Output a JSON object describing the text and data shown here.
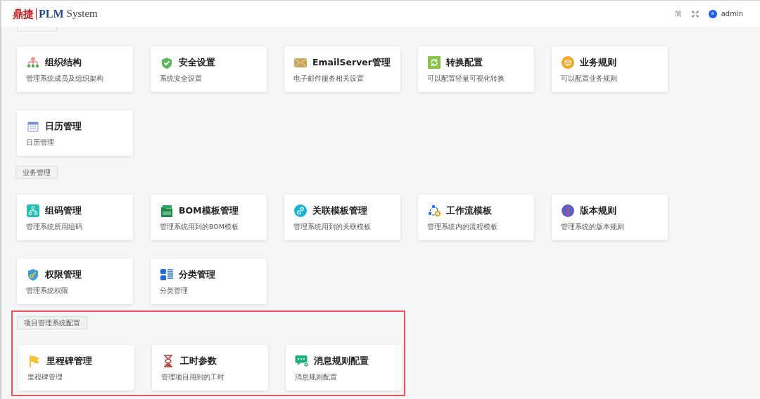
{
  "header": {
    "logo_cn": "鼎捷",
    "logo_en": "PLM",
    "logo_sub": "System",
    "lang": "简",
    "user_avatar": "a",
    "user": "admin"
  },
  "sections": [
    {
      "highlighted": false,
      "cards": [
        {
          "title": "组织结构",
          "desc": "管理系统成员及组织架构"
        },
        {
          "title": "安全设置",
          "desc": "系统安全设置"
        },
        {
          "title": "EmailServer管理",
          "desc": "电子邮件服务相关设置"
        },
        {
          "title": "转换配置",
          "desc": "可以配置轻量可视化转换"
        },
        {
          "title": "业务规则",
          "desc": "可以配置业务规则"
        },
        {
          "title": "日历管理",
          "desc": "日历管理"
        }
      ]
    },
    {
      "label": "业务管理",
      "highlighted": false,
      "cards": [
        {
          "title": "组码管理",
          "desc": "管理系统所用组码"
        },
        {
          "title": "BOM模板管理",
          "desc": "管理系统用到的BOM模板"
        },
        {
          "title": "关联模板管理",
          "desc": "管理系统用到的关联模板"
        },
        {
          "title": "工作流模板",
          "desc": "管理系统内的流程模板"
        },
        {
          "title": "版本规则",
          "desc": "管理系统的版本规则"
        },
        {
          "title": "权限管理",
          "desc": "管理系统权限"
        },
        {
          "title": "分类管理",
          "desc": "分类管理"
        }
      ]
    },
    {
      "label": "项目管理系统配置",
      "highlighted": true,
      "cards": [
        {
          "title": "里程碑管理",
          "desc": "里程碑管理"
        },
        {
          "title": "工时参数",
          "desc": "管理项目用到的工时"
        },
        {
          "title": "消息规则配置",
          "desc": "消息规则配置"
        }
      ]
    }
  ]
}
